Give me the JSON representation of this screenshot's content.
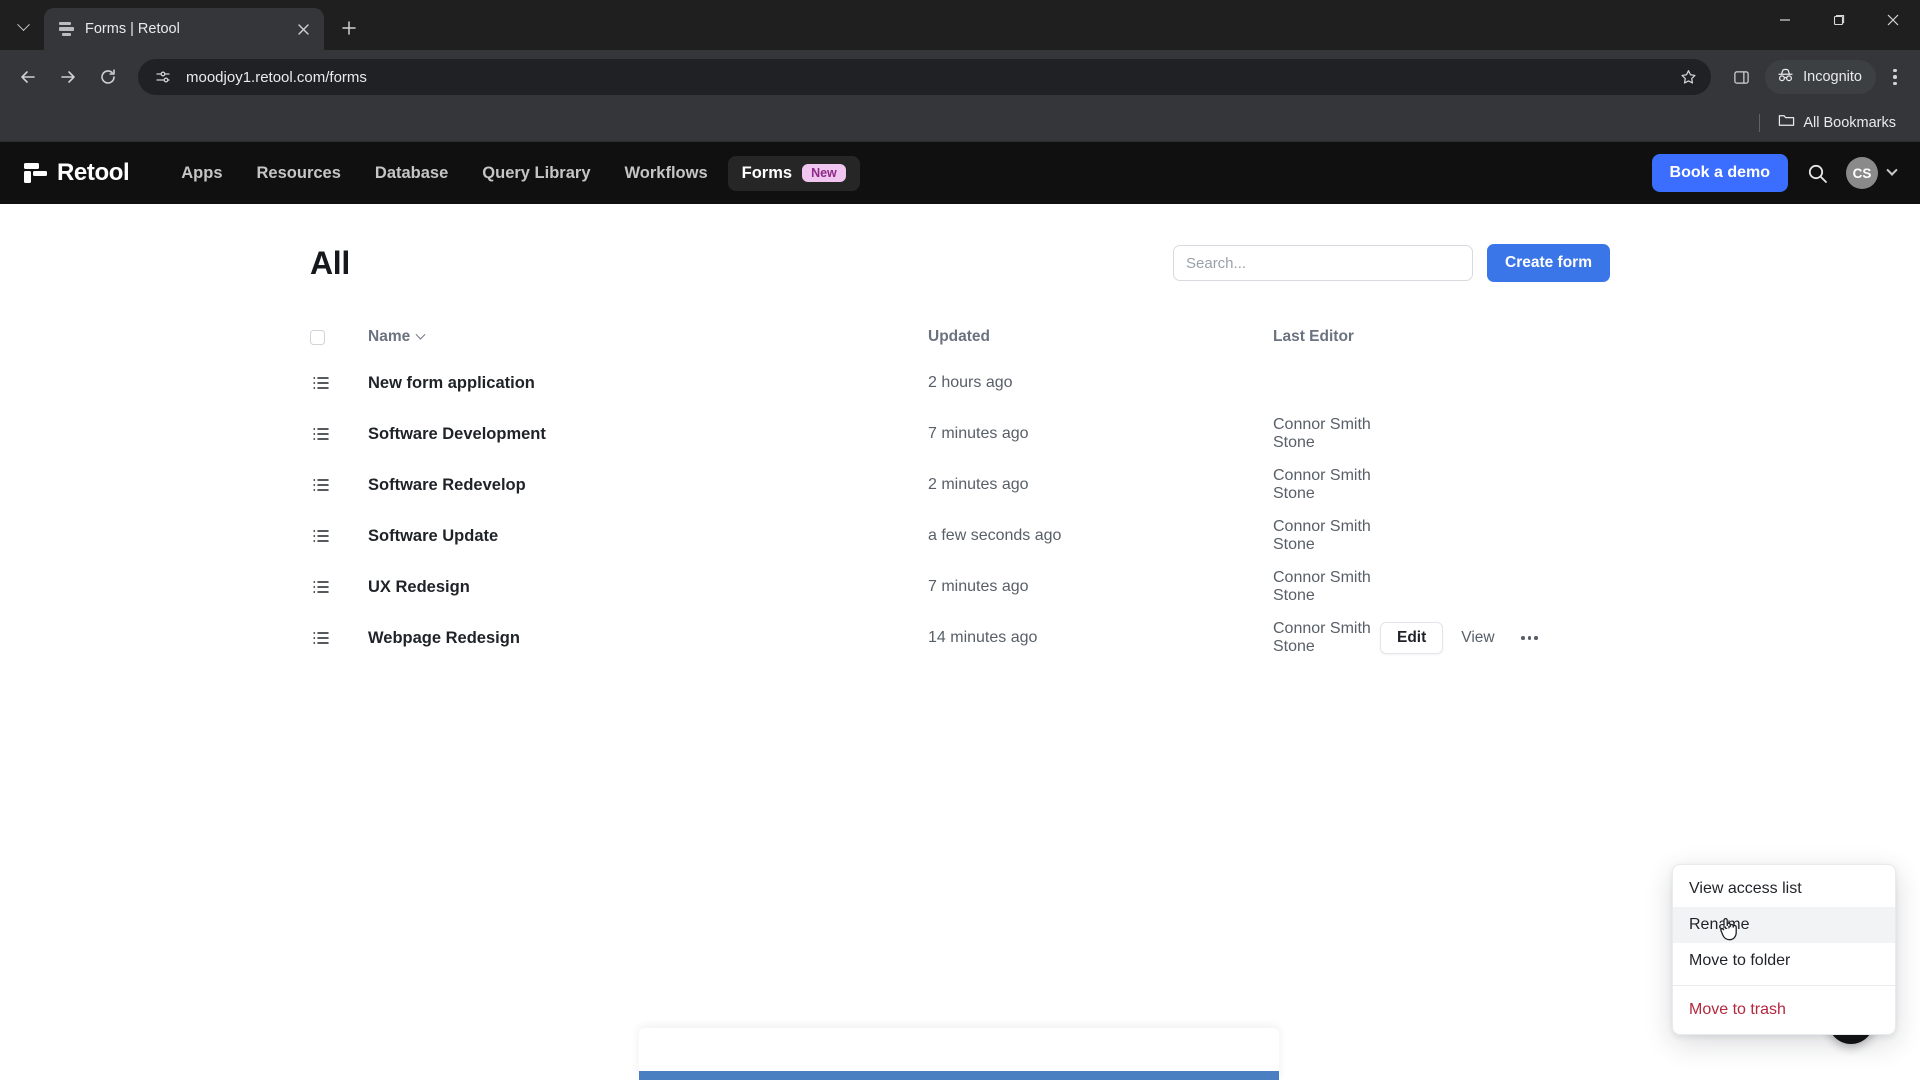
{
  "browser": {
    "tab": {
      "title": "Forms | Retool",
      "favicon_icon": "retool-favicon-icon",
      "close_icon": "close-icon"
    },
    "tab_list_icon": "chevron-down-icon",
    "new_tab_label": "+",
    "back_icon": "arrow-left-icon",
    "forward_icon": "arrow-right-icon",
    "reload_icon": "reload-icon",
    "site_info_icon": "site-settings-icon",
    "url": "moodjoy1.retool.com/forms",
    "bookmark_icon": "star-icon",
    "side_panel_icon": "side-panel-icon",
    "incognito_label": "Incognito",
    "incognito_icon": "incognito-icon",
    "menu_icon": "three-dot-menu-icon",
    "window_minimize_icon": "minimize-icon",
    "window_maximize_icon": "maximize-icon",
    "window_close_icon": "window-close-icon",
    "bookmarks_bar": {
      "folder_icon": "folder-icon",
      "label": "All Bookmarks"
    }
  },
  "retool_nav": {
    "logo_text": "Retool",
    "logo_icon": "retool-logo-icon",
    "links": [
      {
        "label": "Apps",
        "active": false
      },
      {
        "label": "Resources",
        "active": false
      },
      {
        "label": "Database",
        "active": false
      },
      {
        "label": "Query Library",
        "active": false
      },
      {
        "label": "Workflows",
        "active": false
      },
      {
        "label": "Forms",
        "active": true,
        "badge": "New"
      }
    ],
    "demo_button": "Book a demo",
    "search_icon": "search-icon",
    "avatar_initials": "CS",
    "avatar_caret_icon": "chevron-down-icon",
    "accent_blue": "#3b6eff",
    "badge_bg": "#f0c5ef",
    "badge_color": "#8b2c87"
  },
  "main": {
    "title": "All",
    "search_placeholder": "Search...",
    "search_value": "",
    "create_button": "Create form",
    "create_button_color": "#3b76e8",
    "columns": {
      "name": "Name",
      "updated": "Updated",
      "last_editor": "Last Editor",
      "sort_icon": "chevron-down-icon",
      "select_all_icon": "checkbox-unchecked-icon"
    },
    "rows": [
      {
        "icon": "form-list-icon",
        "name": "New form application",
        "updated": "2 hours ago",
        "editor": ""
      },
      {
        "icon": "form-list-icon",
        "name": "Software Development",
        "updated": "7 minutes ago",
        "editor": "Connor Smith Stone"
      },
      {
        "icon": "form-list-icon",
        "name": "Software Redevelop",
        "updated": "2 minutes ago",
        "editor": "Connor Smith Stone"
      },
      {
        "icon": "form-list-icon",
        "name": "Software Update",
        "updated": "a few seconds ago",
        "editor": "Connor Smith Stone"
      },
      {
        "icon": "form-list-icon",
        "name": "UX Redesign",
        "updated": "7 minutes ago",
        "editor": "Connor Smith Stone"
      },
      {
        "icon": "form-list-icon",
        "name": "Webpage Redesign",
        "updated": "14 minutes ago",
        "editor": "Connor Smith Stone"
      }
    ],
    "row_actions": {
      "edit": "Edit",
      "view": "View",
      "more_icon": "ellipsis-icon"
    },
    "active_row_index": 5
  },
  "context_menu": {
    "items": [
      {
        "label": "View access list",
        "danger": false,
        "hovered": false
      },
      {
        "label": "Rename",
        "danger": false,
        "hovered": true
      },
      {
        "label": "Move to folder",
        "danger": false,
        "hovered": false
      },
      {
        "label": "Move to trash",
        "danger": true,
        "hovered": false
      }
    ],
    "danger_color": "#b4273d"
  },
  "help": {
    "label": "?",
    "icon": "help-question-icon"
  }
}
